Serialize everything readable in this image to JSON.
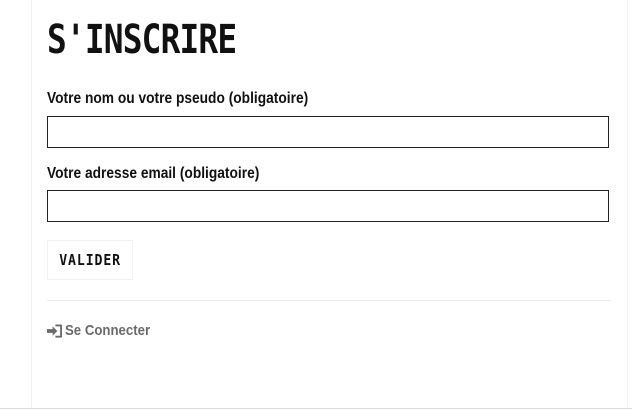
{
  "form": {
    "title": "S'INSCRIRE",
    "name_label": "Votre nom ou votre pseudo (obligatoire)",
    "name_value": "",
    "email_label": "Votre adresse email (obligatoire)",
    "email_value": "",
    "submit_label": "VALIDER"
  },
  "footer": {
    "login_icon": "sign-in-icon",
    "login_label": "Se Connecter"
  }
}
